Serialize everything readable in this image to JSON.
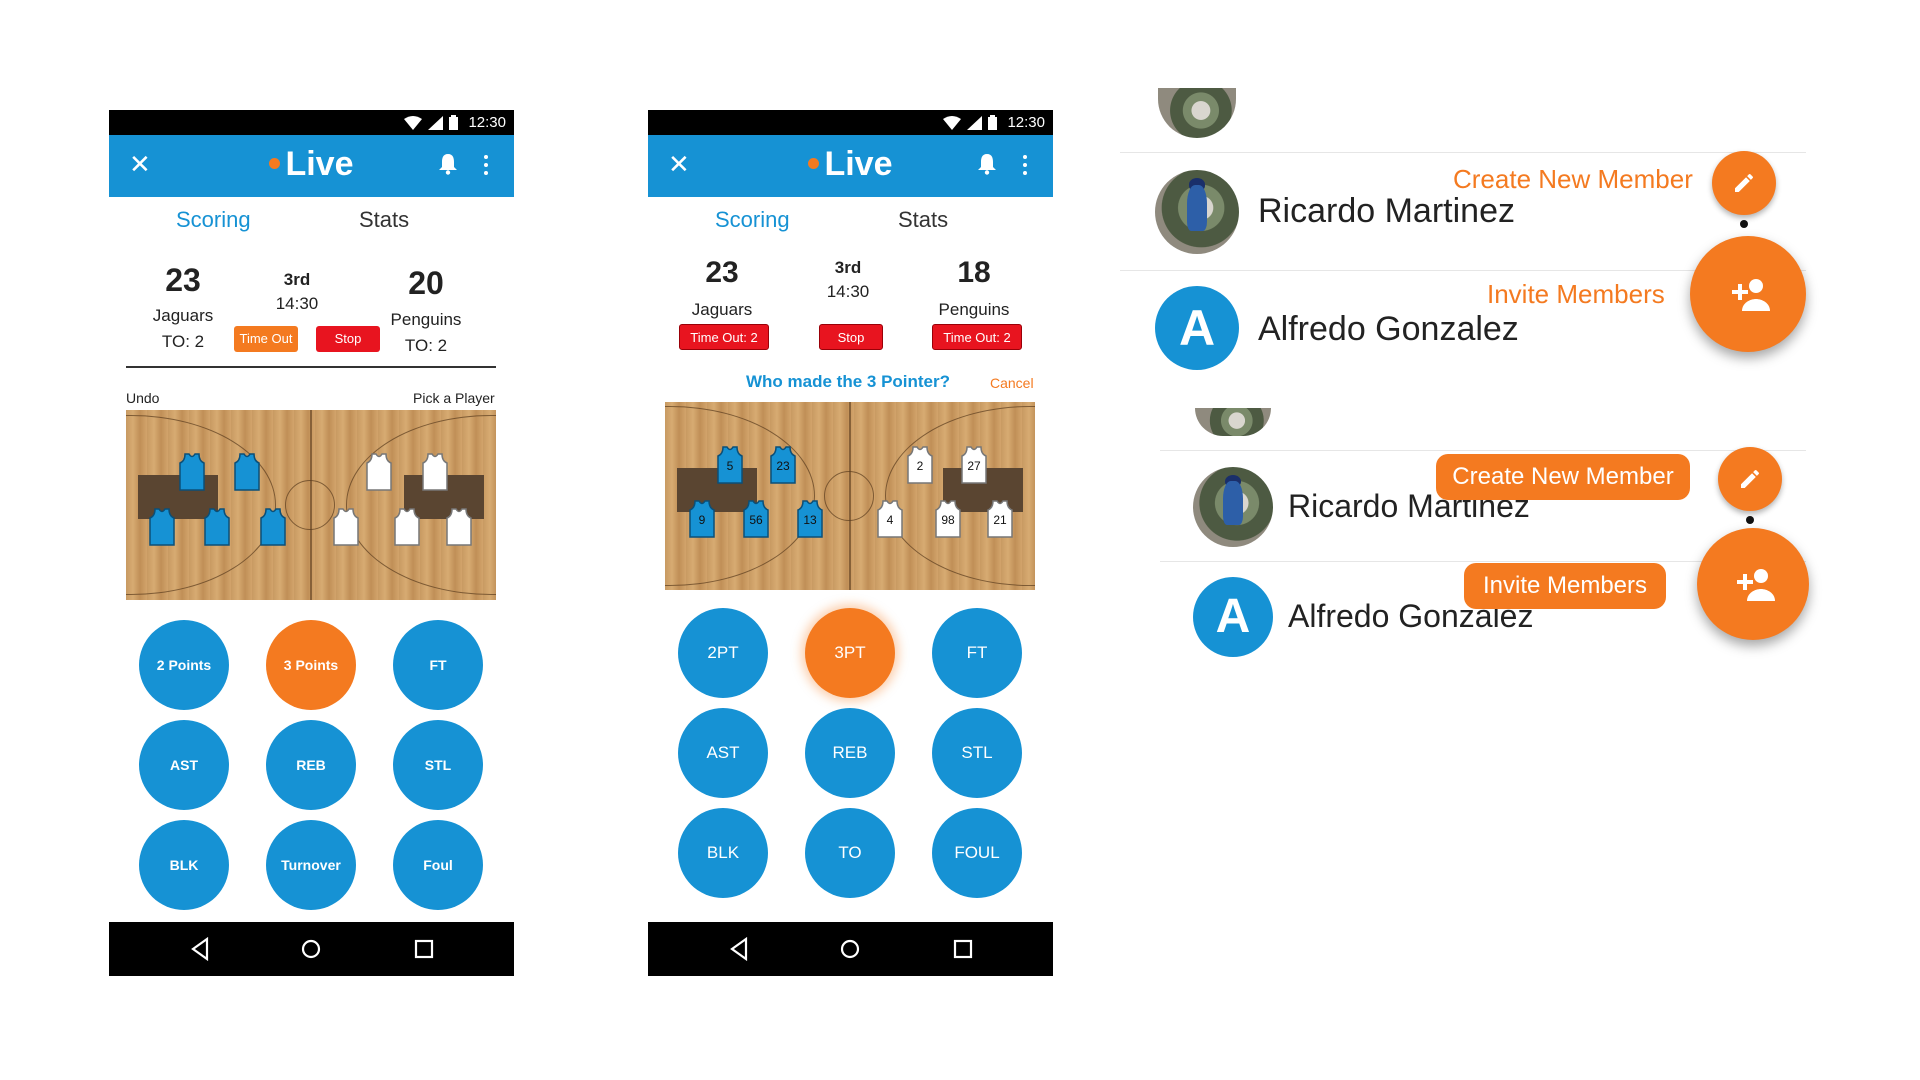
{
  "phone1": {
    "status": {
      "time": "12:30"
    },
    "appbar": {
      "title": "Live"
    },
    "tabs": {
      "scoring": "Scoring",
      "stats": "Stats"
    },
    "scoreboard": {
      "home_score": "23",
      "home_team": "Jaguars",
      "home_to": "TO: 2",
      "period": "3rd",
      "clock": "14:30",
      "away_score": "20",
      "away_team": "Penguins",
      "away_to": "TO: 2",
      "timeout_label": "Time Out",
      "stop_label": "Stop"
    },
    "court_labels": {
      "undo": "Undo",
      "pick_player": "Pick a Player"
    },
    "buttons": [
      "2 Points",
      "3 Points",
      "FT",
      "AST",
      "REB",
      "STL",
      "BLK",
      "Turnover",
      "Foul"
    ],
    "highlighted_button": "3 Points"
  },
  "phone2": {
    "status": {
      "time": "12:30"
    },
    "appbar": {
      "title": "Live"
    },
    "tabs": {
      "scoring": "Scoring",
      "stats": "Stats"
    },
    "scoreboard": {
      "home_score": "23",
      "home_team": "Jaguars",
      "home_timeout": "Time Out: 2",
      "period": "3rd",
      "clock": "14:30",
      "away_score": "18",
      "away_team": "Penguins",
      "away_timeout": "Time Out: 2",
      "stop_label": "Stop"
    },
    "prompt": {
      "question": "Who made the 3 Pointer?",
      "cancel": "Cancel"
    },
    "jersey_numbers_home": [
      "5",
      "23",
      "9",
      "56",
      "13"
    ],
    "jersey_numbers_away": [
      "2",
      "27",
      "4",
      "98",
      "21"
    ],
    "buttons": [
      "2PT",
      "3PT",
      "FT",
      "AST",
      "REB",
      "STL",
      "BLK",
      "TO",
      "FOUL"
    ],
    "highlighted_button": "3PT"
  },
  "members_panel_a": {
    "members": [
      {
        "name": "Ricardo Martinez",
        "avatar": "photo"
      },
      {
        "name": "Alfredo Gonzalez",
        "avatar_letter": "A"
      }
    ],
    "create_label": "Create New Member",
    "invite_label": "Invite Members",
    "edit_icon": "pencil-icon",
    "invite_icon": "person-add-icon"
  },
  "members_panel_b": {
    "members": [
      {
        "name": "Ricardo Martinez",
        "avatar": "photo"
      },
      {
        "name": "Alfredo Gonzalez",
        "avatar_letter": "A"
      }
    ],
    "create_label": "Create New Member",
    "invite_label": "Invite Members",
    "edit_icon": "pencil-icon",
    "invite_icon": "person-add-icon"
  },
  "colors": {
    "primary": "#1692d4",
    "accent": "#f47a20",
    "danger": "#e8141f"
  }
}
